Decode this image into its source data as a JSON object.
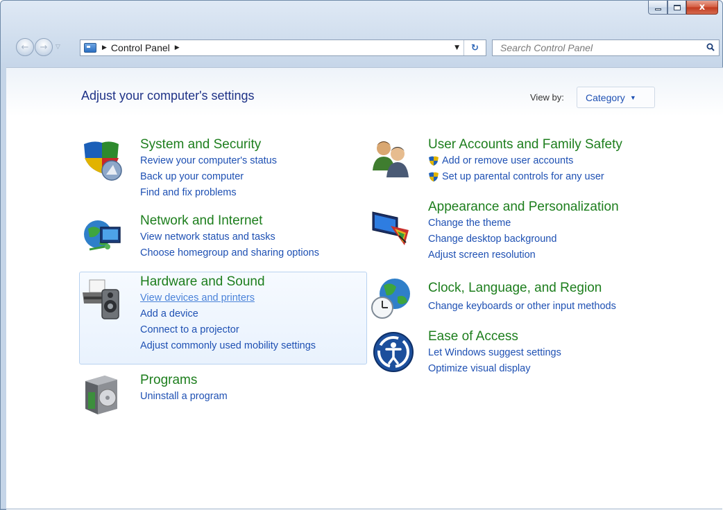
{
  "nav": {
    "back_arrow": "←",
    "forward_arrow": "→",
    "history_caret": "▽"
  },
  "address": {
    "crumb_arrow": "▶",
    "path": "Control Panel",
    "dropdown_caret": "▼",
    "refresh_glyph": "↻"
  },
  "search": {
    "placeholder": "Search Control Panel"
  },
  "window_buttons": {
    "close": "x"
  },
  "header": {
    "title": "Adjust your computer's settings",
    "view_by_label": "View by:",
    "view_by_value": "Category",
    "view_by_caret": "▼"
  },
  "categories": [
    {
      "title": "System and Security",
      "icon": "shield-icon",
      "links": [
        "Review your computer's status",
        "Back up your computer",
        "Find and fix problems"
      ]
    },
    {
      "title": "Network and Internet",
      "icon": "network-globe-icon",
      "links": [
        "View network status and tasks",
        "Choose homegroup and sharing options"
      ]
    },
    {
      "title": "Hardware and Sound",
      "icon": "printer-speaker-icon",
      "links": [
        "View devices and printers",
        "Add a device",
        "Connect to a projector",
        "Adjust commonly used mobility settings"
      ]
    },
    {
      "title": "Programs",
      "icon": "programs-box-icon",
      "links": [
        "Uninstall a program"
      ]
    },
    {
      "title": "User Accounts and Family Safety",
      "icon": "users-icon",
      "links": [
        "Add or remove user accounts",
        "Set up parental controls for any user"
      ]
    },
    {
      "title": "Appearance and Personalization",
      "icon": "monitor-palette-icon",
      "links": [
        "Change the theme",
        "Change desktop background",
        "Adjust screen resolution"
      ]
    },
    {
      "title": "Clock, Language, and Region",
      "icon": "globe-clock-icon",
      "links": [
        "Change keyboards or other input methods"
      ]
    },
    {
      "title": "Ease of Access",
      "icon": "ease-of-access-icon",
      "links": [
        "Let Windows suggest settings",
        "Optimize visual display"
      ]
    }
  ],
  "colors": {
    "category_title": "#1d7e1d",
    "link": "#1e50b3",
    "page_title": "#1e3287",
    "highlight_border": "#b8d2f0"
  }
}
